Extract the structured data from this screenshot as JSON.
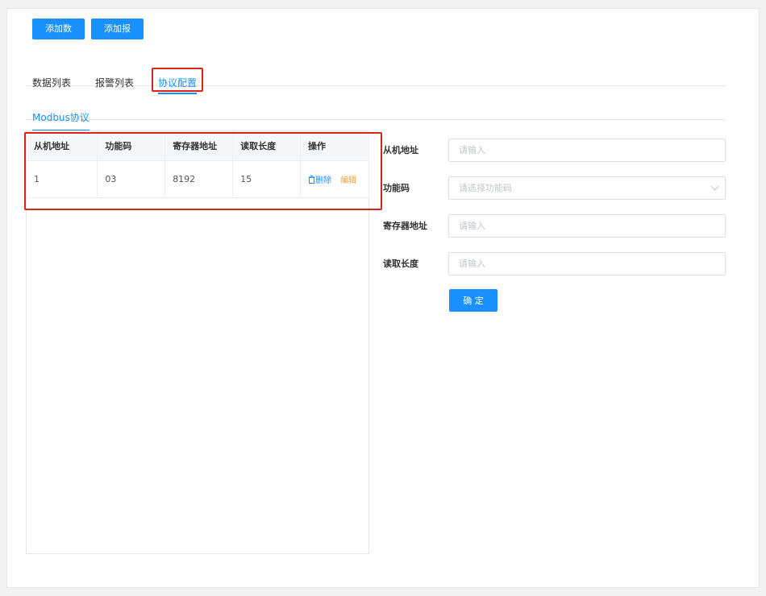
{
  "toolbar": {
    "add_data_label": "添加数据",
    "add_alarm_label": "添加报警"
  },
  "tabs": {
    "items": [
      {
        "label": "数据列表",
        "active": false
      },
      {
        "label": "报警列表",
        "active": false
      },
      {
        "label": "协议配置",
        "active": true
      }
    ]
  },
  "subtabs": {
    "active_label": "Modbus协议"
  },
  "table": {
    "headers": [
      "从机地址",
      "功能码",
      "寄存器地址",
      "读取长度",
      "操作"
    ],
    "rows": [
      {
        "slave_address": "1",
        "function_code": "03",
        "register_address": "8192",
        "read_length": "15"
      }
    ],
    "delete_label": "删除",
    "edit_label": "编辑"
  },
  "form": {
    "slave_address": {
      "label": "从机地址",
      "placeholder": "请输入",
      "value": ""
    },
    "function_code": {
      "label": "功能码",
      "placeholder": "请选择功能码",
      "value": ""
    },
    "register_address": {
      "label": "寄存器地址",
      "placeholder": "请输入",
      "value": ""
    },
    "read_length": {
      "label": "读取长度",
      "placeholder": "请输入",
      "value": ""
    },
    "confirm_label": "确 定"
  },
  "colors": {
    "primary": "#1890ff",
    "highlight": "#d9231c",
    "edit": "#e6a23c"
  },
  "icons": {
    "delete": "trash-icon",
    "select": "chevron-down-icon"
  }
}
